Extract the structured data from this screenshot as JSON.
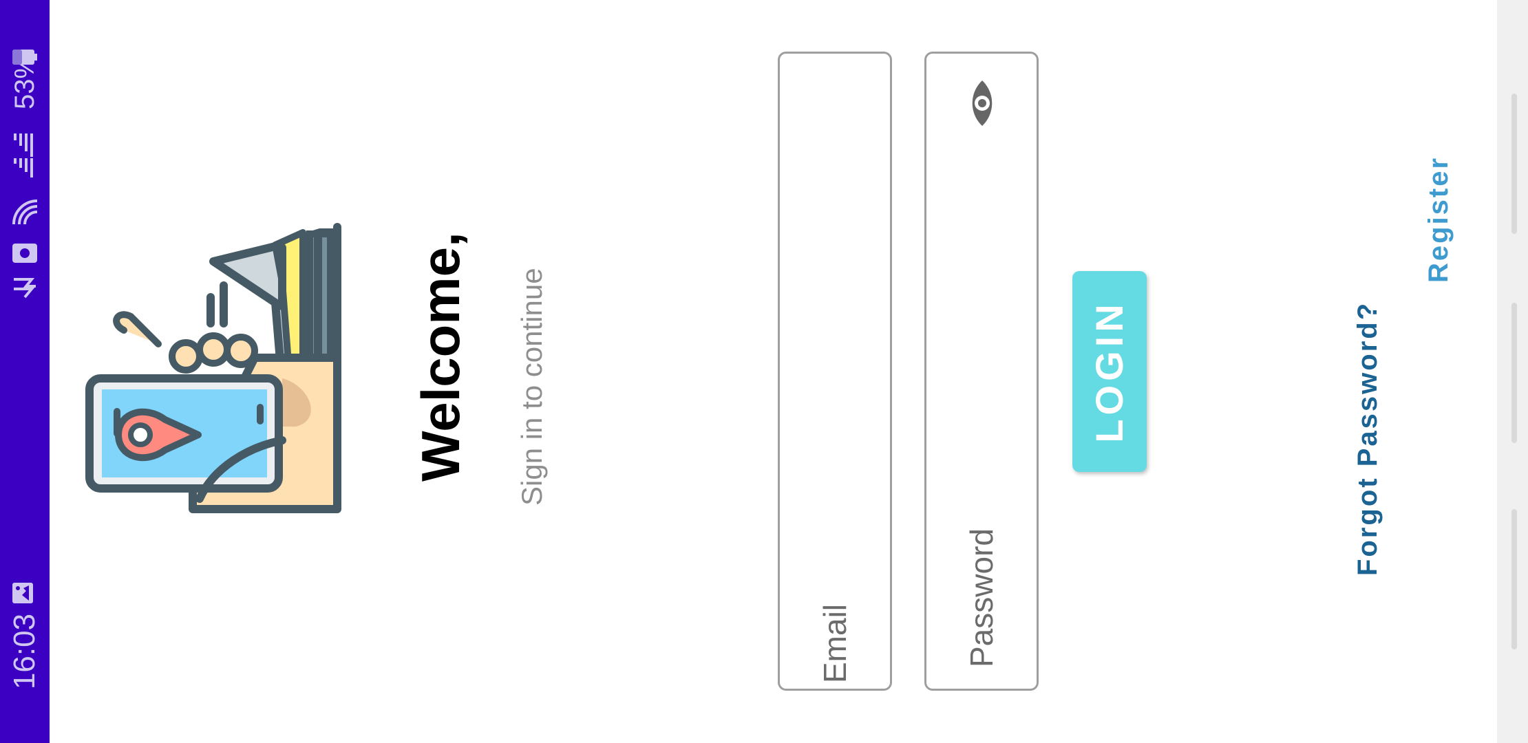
{
  "status_bar": {
    "time": "16:03",
    "battery": "53%",
    "icons": [
      "image-icon",
      "notification-icon",
      "bag-icon",
      "wifi-icon",
      "signal-icon",
      "battery-icon"
    ],
    "background_color": "#3b00c2"
  },
  "login": {
    "welcome_title": "Welcome,",
    "welcome_subtitle": "Sign in to continue",
    "email_field": {
      "placeholder": "Email",
      "value": ""
    },
    "password_field": {
      "placeholder": "Password",
      "value": ""
    },
    "login_button_label": "LOGIN",
    "forgot_password_label": "Forgot Password?",
    "register_label": "Register"
  },
  "colors": {
    "accent_button": "#64dbe3",
    "forgot_link": "#1b6393",
    "register_link": "#3d9bd0"
  }
}
